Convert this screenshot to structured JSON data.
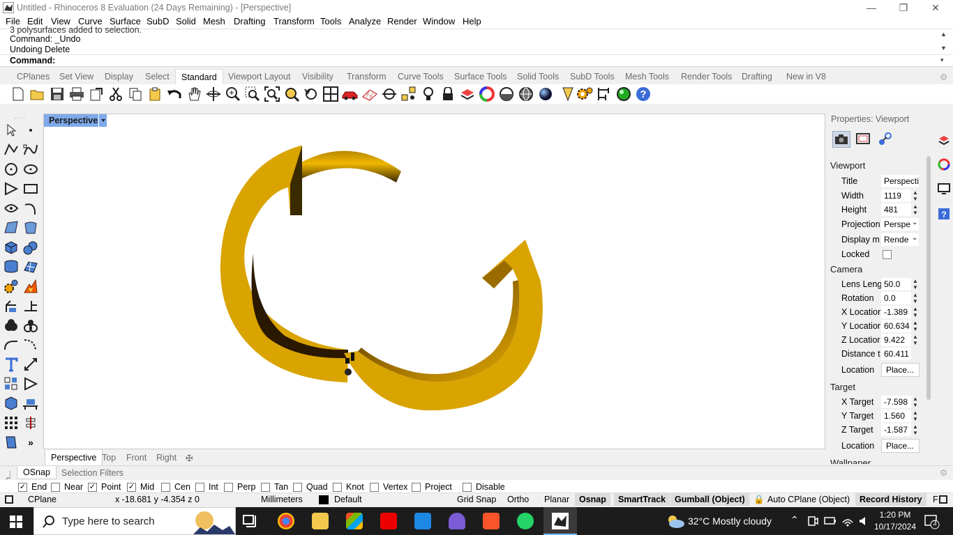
{
  "window": {
    "title": "Untitled - Rhinoceros 8 Evaluation (24 Days Remaining) - [Perspective]",
    "controls": [
      "minimize",
      "restore",
      "close"
    ]
  },
  "menu": [
    "File",
    "Edit",
    "View",
    "Curve",
    "Surface",
    "SubD",
    "Solid",
    "Mesh",
    "Drafting",
    "Transform",
    "Tools",
    "Analyze",
    "Render",
    "Window",
    "Help"
  ],
  "command_history": [
    "3 polysurfaces added to selection.",
    "Command: _Undo",
    "Undoing Delete"
  ],
  "command_prompt": "Command:",
  "toolbar_tabs": [
    "CPlanes",
    "Set View",
    "Display",
    "Select",
    "Standard",
    "Viewport Layout",
    "Visibility",
    "Transform",
    "Curve Tools",
    "Surface Tools",
    "Solid Tools",
    "SubD Tools",
    "Mesh Tools",
    "Render Tools",
    "Drafting",
    "New in V8"
  ],
  "active_toolbar_tab": "Standard",
  "viewport": {
    "active_title": "Perspective",
    "tabs": [
      "Perspective",
      "Top",
      "Front",
      "Right"
    ],
    "model_color": "#d9a300"
  },
  "properties": {
    "header": "Properties: Viewport",
    "viewport_section": "Viewport",
    "title_label": "Title",
    "title_value": "Perspecti",
    "width_label": "Width",
    "width_value": "1119",
    "height_label": "Height",
    "height_value": "481",
    "projection_label": "Projection",
    "projection_value": "Perspe",
    "display_label": "Display m",
    "display_value": "Rende",
    "locked_label": "Locked",
    "camera_section": "Camera",
    "lens_label": "Lens Leng",
    "lens_value": "50.0",
    "rotation_label": "Rotation",
    "rotation_value": "0.0",
    "xloc_label": "X Locatior",
    "xloc_value": "-1.389",
    "yloc_label": "Y Locatior",
    "yloc_value": "60.634",
    "zloc_label": "Z Locatior",
    "zloc_value": "9.422",
    "dist_label": "Distance t",
    "dist_value": "60.411",
    "location_label": "Location",
    "place_button": "Place...",
    "target_section": "Target",
    "xt_label": "X Target",
    "xt_value": "-7.598",
    "yt_label": "Y Target",
    "yt_value": "1.560",
    "zt_label": "Z Target",
    "zt_value": "-1.587",
    "tlocation_label": "Location",
    "tplace_button": "Place...",
    "wallpaper_section": "Wallpaper"
  },
  "osnap_tabs": [
    "OSnap",
    "Selection Filters"
  ],
  "osnap_side": "OSn...",
  "osnaps": [
    {
      "label": "End",
      "checked": true
    },
    {
      "label": "Near",
      "checked": false
    },
    {
      "label": "Point",
      "checked": true
    },
    {
      "label": "Mid",
      "checked": true
    },
    {
      "label": "Cen",
      "checked": false
    },
    {
      "label": "Int",
      "checked": false
    },
    {
      "label": "Perp",
      "checked": false
    },
    {
      "label": "Tan",
      "checked": false
    },
    {
      "label": "Quad",
      "checked": false
    },
    {
      "label": "Knot",
      "checked": false
    },
    {
      "label": "Vertex",
      "checked": false
    },
    {
      "label": "Project",
      "checked": false
    },
    {
      "label": "Disable",
      "checked": false
    }
  ],
  "status": {
    "cplane": "CPlane",
    "coords": "x -18.681  y -4.354  z 0",
    "units": "Millimeters",
    "layer": "Default",
    "grid_snap": "Grid Snap",
    "ortho": "Ortho",
    "planar": "Planar",
    "osnap": "Osnap",
    "smarttrack": "SmartTrack",
    "gumball": "Gumball (Object)",
    "auto_cplane": "Auto CPlane (Object)",
    "record_history": "Record History",
    "filter": "F"
  },
  "taskbar": {
    "search_placeholder": "Type here to search",
    "weather": "32°C  Mostly cloudy",
    "time": "1:20 PM",
    "date": "10/17/2024",
    "notifications": "3"
  }
}
